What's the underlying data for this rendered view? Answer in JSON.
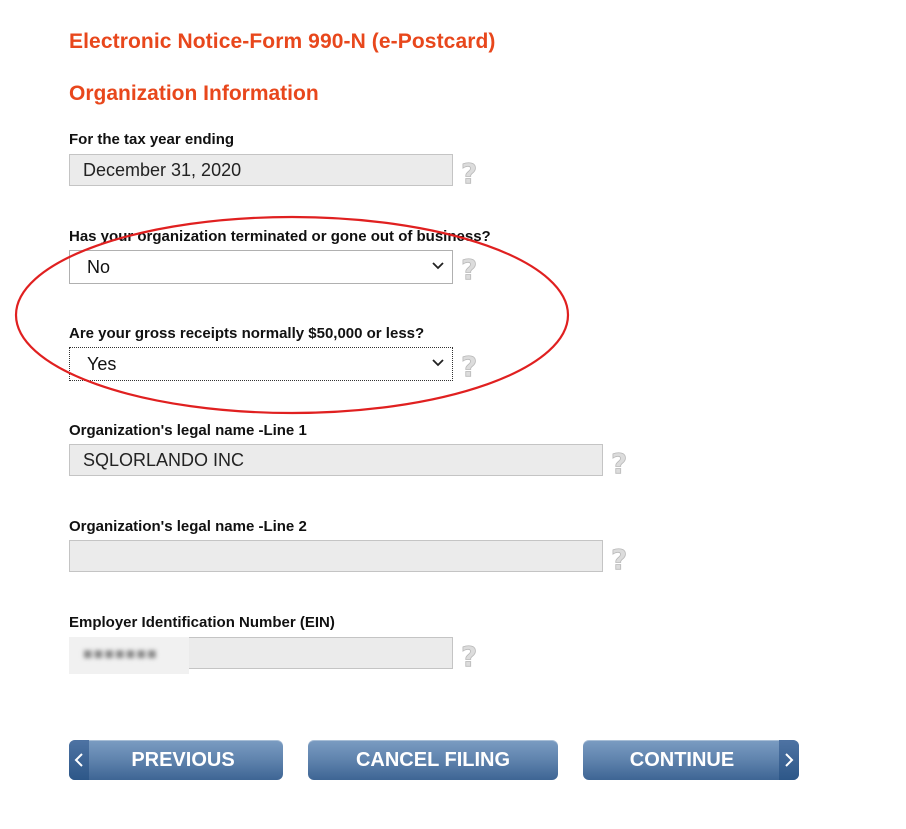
{
  "header": {
    "title": "Electronic Notice-Form 990-N (e-Postcard)",
    "section": "Organization Information"
  },
  "fields": {
    "tax_year": {
      "label": "For the tax year ending",
      "value": "December 31, 2020"
    },
    "terminated": {
      "label": "Has your organization terminated or gone out of business?",
      "value": "No"
    },
    "gross_receipts": {
      "label": "Are your gross receipts normally $50,000 or less?",
      "value": "Yes"
    },
    "legal_name_1": {
      "label": "Organization's legal name -Line 1",
      "value": "SQLORLANDO INC"
    },
    "legal_name_2": {
      "label": "Organization's legal name -Line 2",
      "value": ""
    },
    "ein": {
      "label": "Employer Identification Number (EIN)",
      "value": ""
    }
  },
  "buttons": {
    "previous": "PREVIOUS",
    "cancel": "CANCEL FILING",
    "continue": "CONTINUE"
  },
  "colors": {
    "heading": "#e8471c",
    "button": "#5f83ad",
    "annotation": "#e02020"
  },
  "icons": {
    "help": "help-question-icon",
    "dropdown": "chevron-down-icon",
    "previous": "chevron-left-icon",
    "next": "chevron-right-icon"
  }
}
